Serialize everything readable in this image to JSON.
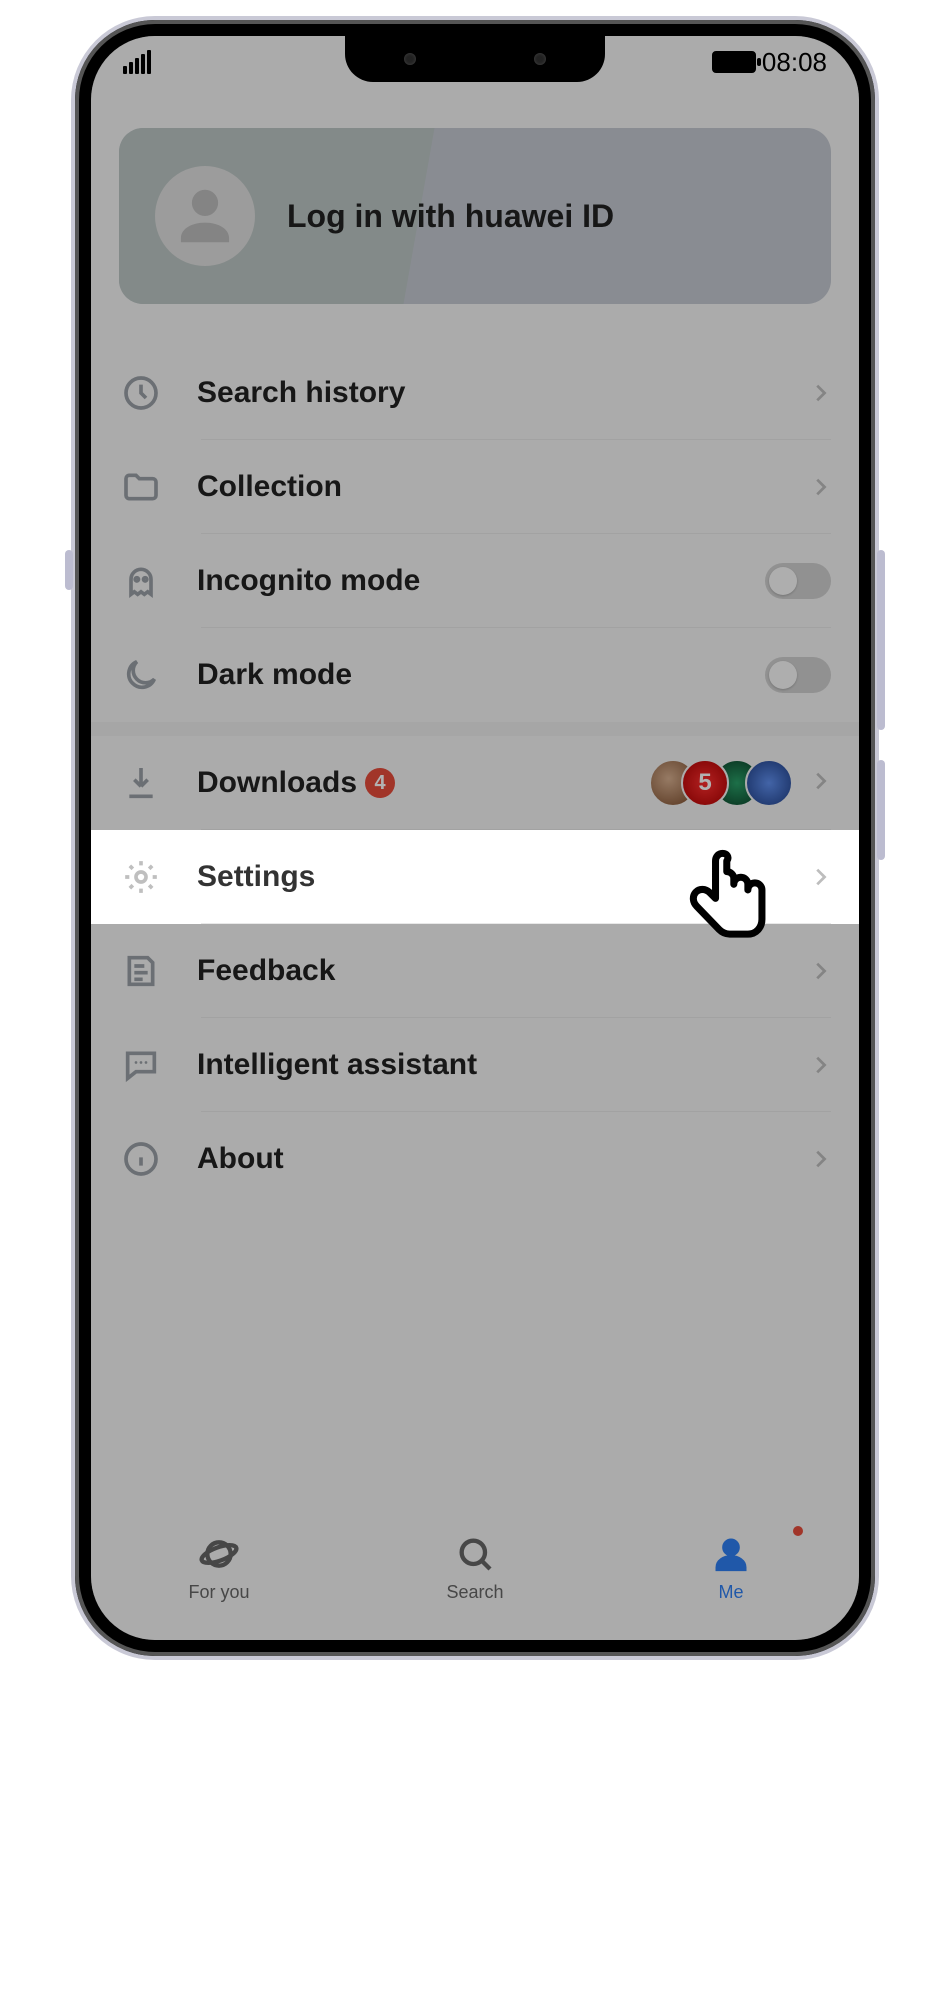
{
  "status": {
    "time": "08:08"
  },
  "login": {
    "prompt": "Log in with huawei ID"
  },
  "menu": {
    "search_history": "Search history",
    "collection": "Collection",
    "incognito_mode": "Incognito mode",
    "dark_mode": "Dark mode",
    "downloads": "Downloads",
    "downloads_badge": "4",
    "settings": "Settings",
    "feedback": "Feedback",
    "intelligent_assistant": "Intelligent assistant",
    "about": "About"
  },
  "nav": {
    "for_you": "For you",
    "search": "Search",
    "me": "Me"
  },
  "icons": {
    "signal": "signal-icon",
    "battery": "battery-icon",
    "avatar": "person-avatar-icon",
    "clock": "clock-icon",
    "folder": "folder-icon",
    "ghost": "ghost-icon",
    "moon": "moon-icon",
    "download": "download-icon",
    "gear": "gear-icon",
    "feedback": "note-feedback-icon",
    "chat": "chat-bubble-icon",
    "info": "info-icon",
    "chevron": "chevron-right-icon",
    "planet": "planet-icon",
    "magnifier": "magnifier-icon",
    "person_nav": "person-icon",
    "pointer": "pointer-hand-icon"
  },
  "colors": {
    "accent": "#2f7ff2",
    "badge": "#e74c3c",
    "dim": "rgba(0,0,0,0.30)"
  }
}
